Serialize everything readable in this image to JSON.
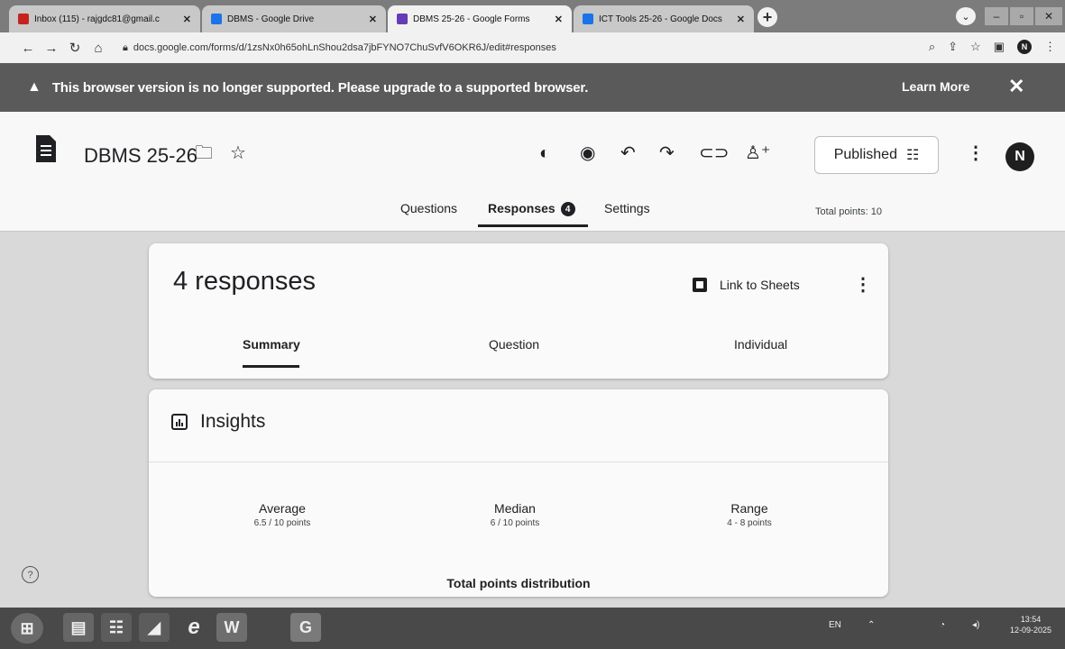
{
  "browser": {
    "tabs": [
      {
        "title": "Inbox (115) - rajgdc81@gmail.c",
        "icon": "gmail-icon",
        "color": "#c5221f",
        "active": false
      },
      {
        "title": "DBMS - Google Drive",
        "icon": "google-drive-icon",
        "color": "#1a73e8",
        "active": false
      },
      {
        "title": "DBMS 25-26 - Google Forms",
        "icon": "google-forms-icon",
        "color": "#673ab7",
        "active": true
      },
      {
        "title": "ICT Tools 25-26 - Google Docs",
        "icon": "google-docs-icon",
        "color": "#1a73e8",
        "active": false
      }
    ],
    "new_tab": "+",
    "url": "docs.google.com/forms/d/1zsNx0h65ohLnShou2dsa7jbFYNO7ChuSvfV6OKR6J/edit#responses"
  },
  "infobar": {
    "message": "This browser version is no longer supported. Please upgrade to a supported browser.",
    "learn_more": "Learn More",
    "close": "✕"
  },
  "form": {
    "title": "DBMS 25-26",
    "publish_label": "Published",
    "avatar_letter": "N",
    "tabs": {
      "questions": "Questions",
      "responses": "Responses",
      "responses_badge": "4",
      "settings": "Settings"
    },
    "total_points": "Total points: 10"
  },
  "responses": {
    "count_label": "4 responses",
    "link_to_sheets": "Link to Sheets",
    "subtabs": [
      "Summary",
      "Question",
      "Individual"
    ]
  },
  "insights": {
    "title": "Insights",
    "average": {
      "label": "Average",
      "value": "6.5 / 10 points"
    },
    "median": {
      "label": "Median",
      "value": "6 / 10 points"
    },
    "range": {
      "label": "Range",
      "value": "4 - 8 points"
    },
    "distribution_title": "Total points distribution"
  },
  "taskbar": {
    "lang": "EN",
    "time": "13:54",
    "date": "12-09-2025"
  }
}
